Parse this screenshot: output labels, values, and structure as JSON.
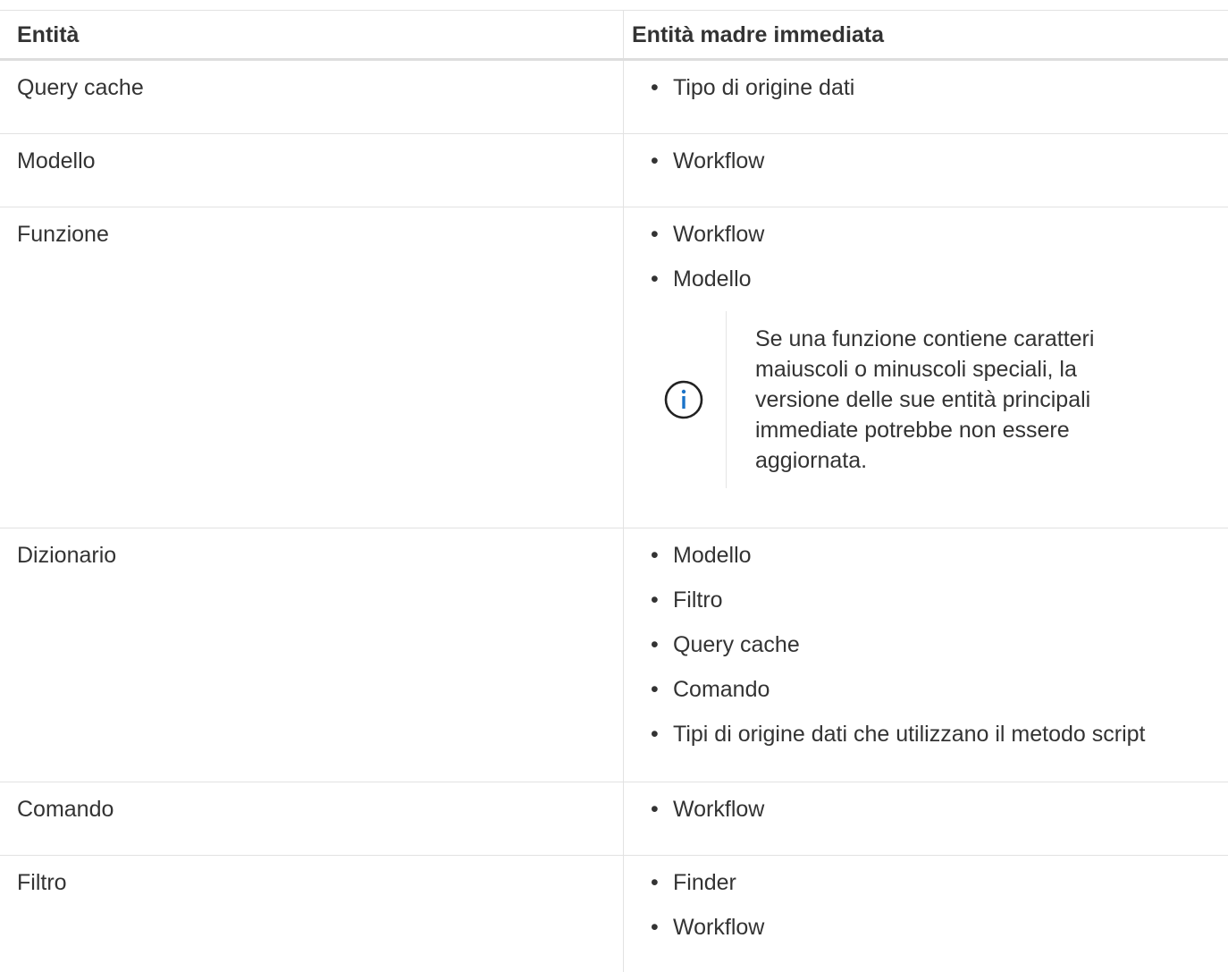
{
  "header": {
    "col1": "Entità",
    "col2": "Entità madre immediata"
  },
  "rows": [
    {
      "entity": "Query cache",
      "parents": [
        "Tipo di origine dati"
      ]
    },
    {
      "entity": "Modello",
      "parents": [
        "Workflow"
      ]
    },
    {
      "entity": "Funzione",
      "parents": [
        "Workflow",
        "Modello"
      ],
      "note": "Se una funzione contiene caratteri maiuscoli o minuscoli speciali, la versione delle sue entità principali immediate potrebbe non essere aggiornata."
    },
    {
      "entity": "Dizionario",
      "parents": [
        "Modello",
        "Filtro",
        "Query cache",
        "Comando",
        "Tipi di origine dati che utilizzano il metodo script"
      ]
    },
    {
      "entity": "Comando",
      "parents": [
        "Workflow"
      ]
    },
    {
      "entity": "Filtro",
      "parents": [
        "Finder",
        "Workflow"
      ]
    }
  ],
  "icons": {
    "note_icon": "info-circle-icon"
  },
  "colors": {
    "info_icon": "#1a73c8",
    "grid_line": "#e2e2e2"
  }
}
